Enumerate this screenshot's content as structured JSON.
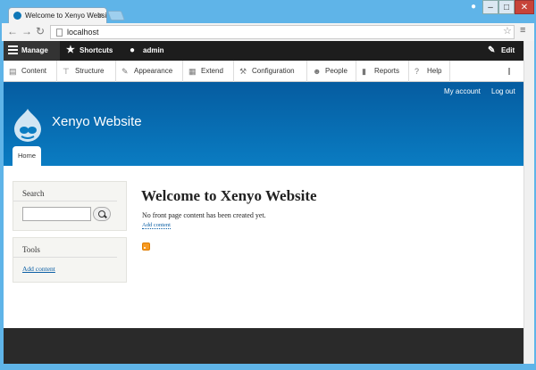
{
  "browser": {
    "tab_title": "Welcome to Xenyo Website",
    "address": "localhost"
  },
  "admin_toolbar": {
    "manage": "Manage",
    "shortcuts": "Shortcuts",
    "user": "admin",
    "edit": "Edit"
  },
  "admin_tray": [
    {
      "label": "Content",
      "icon": "content-icon"
    },
    {
      "label": "Structure",
      "icon": "structure-icon"
    },
    {
      "label": "Appearance",
      "icon": "appearance-icon"
    },
    {
      "label": "Extend",
      "icon": "extend-icon"
    },
    {
      "label": "Configuration",
      "icon": "wrench-icon"
    },
    {
      "label": "People",
      "icon": "people-icon"
    },
    {
      "label": "Reports",
      "icon": "reports-icon"
    },
    {
      "label": "Help",
      "icon": "help-icon"
    }
  ],
  "header": {
    "my_account": "My account",
    "log_out": "Log out",
    "site_name": "Xenyo Website",
    "home_tab": "Home"
  },
  "sidebar": {
    "search_title": "Search",
    "tools_title": "Tools",
    "tools_link": "Add content"
  },
  "main": {
    "title": "Welcome to Xenyo Website",
    "message": "No front page content has been created yet.",
    "add_link": "Add content"
  },
  "colors": {
    "header_top": "#055ca0",
    "header_bottom": "#0a7cc2",
    "toolbar": "#1d1d1d",
    "link": "#0b5fa5"
  }
}
